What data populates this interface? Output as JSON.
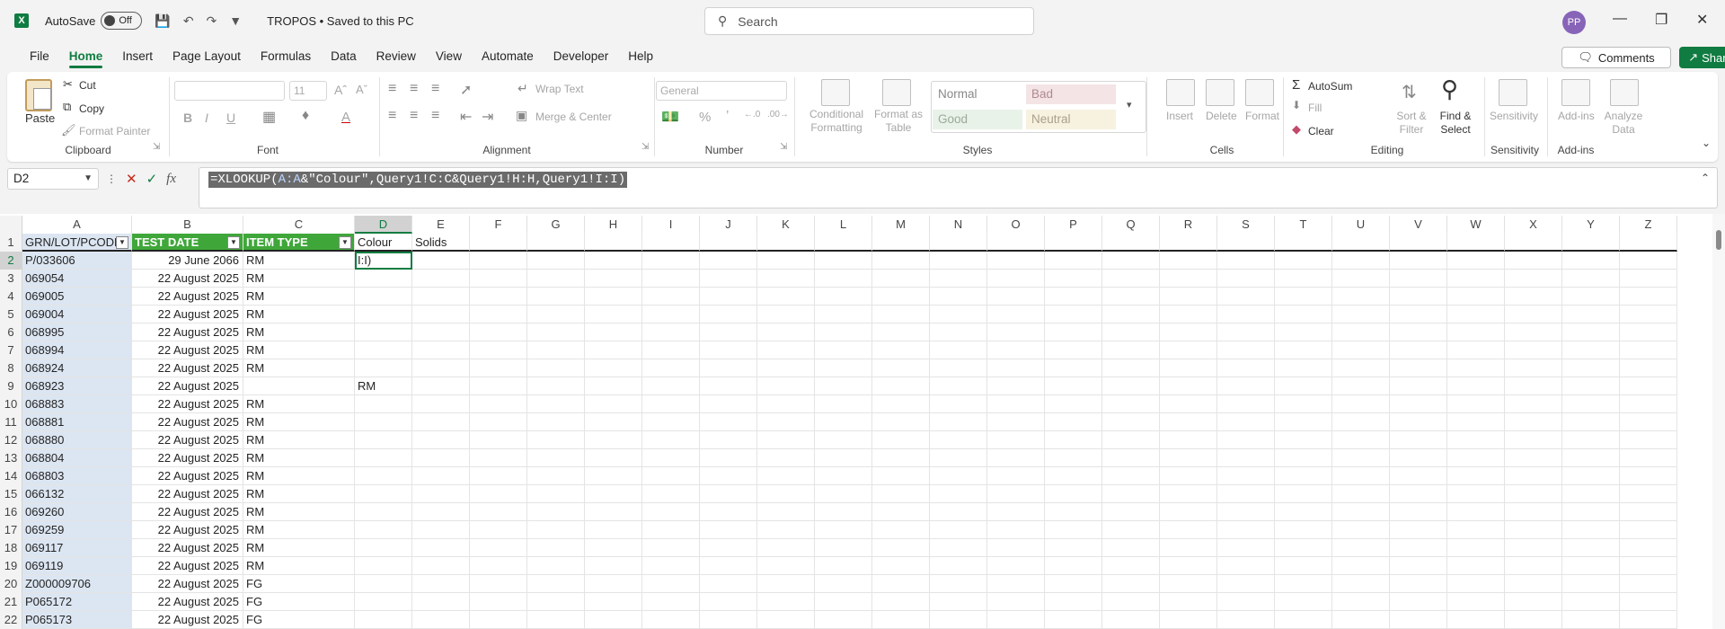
{
  "titlebar": {
    "app_icon": "X",
    "autosave_label": "AutoSave",
    "autosave_state": "Off",
    "doc_title": "TROPOS • Saved to this PC",
    "search_placeholder": "Search",
    "avatar_initials": "PP"
  },
  "menu": {
    "tabs": [
      "File",
      "Home",
      "Insert",
      "Page Layout",
      "Formulas",
      "Data",
      "Review",
      "View",
      "Automate",
      "Developer",
      "Help"
    ],
    "active_tab": "Home",
    "comments_label": "Comments",
    "share_label": "Share"
  },
  "ribbon": {
    "clipboard": {
      "paste": "Paste",
      "cut": "Cut",
      "copy": "Copy",
      "format_painter": "Format Painter",
      "label": "Clipboard"
    },
    "font": {
      "font_size": "11",
      "label": "Font"
    },
    "alignment": {
      "wrap_text": "Wrap Text",
      "merge_center": "Merge & Center",
      "label": "Alignment"
    },
    "number": {
      "format": "General",
      "label": "Number"
    },
    "styles": {
      "conditional": "Conditional Formatting",
      "format_table": "Format as Table",
      "normal": "Normal",
      "bad": "Bad",
      "good": "Good",
      "neutral": "Neutral",
      "label": "Styles"
    },
    "cells": {
      "insert": "Insert",
      "delete": "Delete",
      "format": "Format",
      "label": "Cells"
    },
    "editing": {
      "autosum": "AutoSum",
      "fill": "Fill",
      "clear": "Clear",
      "sort_filter": "Sort & Filter",
      "find_select": "Find & Select",
      "label": "Editing"
    },
    "sensitivity": {
      "button": "Sensitivity",
      "label": "Sensitivity"
    },
    "addins": {
      "button": "Add-ins",
      "analyze": "Analyze Data",
      "label": "Add-ins"
    }
  },
  "formula_bar": {
    "name_box": "D2",
    "formula_prefix": "=XLOOKUP(",
    "formula_ref": "A:A",
    "formula_rest": "&\"Colour\",Query1!C:C&Query1!H:H,Query1!I:I)"
  },
  "grid": {
    "columns": [
      "A",
      "B",
      "C",
      "D",
      "E",
      "F",
      "G",
      "H",
      "I",
      "J",
      "K",
      "L",
      "M",
      "N",
      "O",
      "P",
      "Q",
      "R",
      "S",
      "T",
      "U",
      "V",
      "W",
      "X",
      "Y",
      "Z"
    ],
    "header_row": [
      "GRN/LOT/PCODE",
      "TEST DATE",
      "ITEM TYPE",
      "Colour",
      "Solids"
    ],
    "rows": [
      [
        "P/033606",
        "29 June 2066",
        "RM",
        "I:I)"
      ],
      [
        "069054",
        "22 August 2025",
        "RM",
        ""
      ],
      [
        "069005",
        "22 August 2025",
        "RM",
        ""
      ],
      [
        "069004",
        "22 August 2025",
        "RM",
        ""
      ],
      [
        "068995",
        "22 August 2025",
        "RM",
        ""
      ],
      [
        "068994",
        "22 August 2025",
        "RM",
        ""
      ],
      [
        "068924",
        "22 August 2025",
        "RM",
        ""
      ],
      [
        "068923",
        "22 August 2025",
        "",
        "RM"
      ],
      [
        "068883",
        "22 August 2025",
        "RM",
        ""
      ],
      [
        "068881",
        "22 August 2025",
        "RM",
        ""
      ],
      [
        "068880",
        "22 August 2025",
        "RM",
        ""
      ],
      [
        "068804",
        "22 August 2025",
        "RM",
        ""
      ],
      [
        "068803",
        "22 August 2025",
        "RM",
        ""
      ],
      [
        "066132",
        "22 August 2025",
        "RM",
        ""
      ],
      [
        "069260",
        "22 August 2025",
        "RM",
        ""
      ],
      [
        "069259",
        "22 August 2025",
        "RM",
        ""
      ],
      [
        "069117",
        "22 August 2025",
        "RM",
        ""
      ],
      [
        "069119",
        "22 August 2025",
        "RM",
        ""
      ],
      [
        "Z000009706",
        "22 August 2025",
        "FG",
        ""
      ],
      [
        "P065172",
        "22 August 2025",
        "FG",
        ""
      ],
      [
        "P065173",
        "22 August 2025",
        "FG",
        ""
      ]
    ]
  }
}
